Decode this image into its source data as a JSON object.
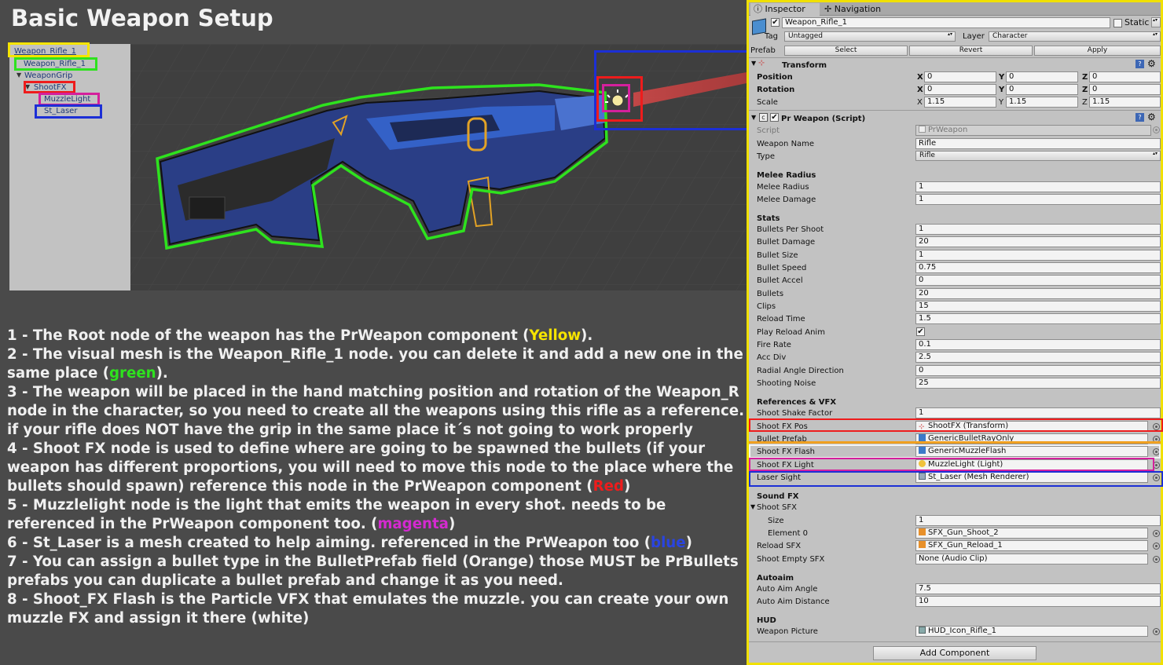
{
  "page_title": "Basic Weapon Setup",
  "hierarchy": {
    "nodes": [
      "Weapon_Rifle_1",
      "Weapon_Rifle_1",
      "WeaponGrip",
      "ShootFX",
      "MuzzleLight",
      "St_Laser"
    ]
  },
  "instructions": {
    "l1_a": "1 - The Root node of the weapon has the PrWeapon component (",
    "l1_hl": "Yellow",
    "l1_b": ").",
    "l2_a": "2 - The visual mesh is the Weapon_Rifle_1 node. you can delete it and add a new one in the same place (",
    "l2_hl": "green",
    "l2_b": ").",
    "l3": "3 - The weapon will be placed in the hand matching position and rotation of the Weapon_R node in the character, so you need to create all the weapons using this rifle as a reference. if your rifle does NOT have the grip in the same place it´s not going to work properly",
    "l4_a": "4 - Shoot FX node is used to define where are going to be spawned the bullets (if your weapon has different proportions, you will need to move this node to the place where the bullets should spawn) reference this node in the PrWeapon component (",
    "l4_hl": "Red",
    "l4_b": ")",
    "l5_a": "5 - Muzzlelight node is the light that emits the weapon in every shot. needs to be referenced in the PrWeapon component too. (",
    "l5_hl": "magenta",
    "l5_b": ")",
    "l6_a": "6 - St_Laser is a mesh created to help aiming. referenced in the PrWeapon too (",
    "l6_hl": "blue",
    "l6_b": ")",
    "l7": "7 - You can assign a bullet type in the BulletPrefab field (Orange) those MUST be PrBullets prefabs you can duplicate a bullet prefab and change it as you need.",
    "l8": "8 - Shoot_FX Flash is the Particle VFX that emulates the muzzle. you can create your own muzzle FX and assign it there (white)"
  },
  "inspector": {
    "tab_inspector": "Inspector",
    "tab_navigation": "Navigation",
    "object_name": "Weapon_Rifle_1",
    "static_label": "Static",
    "tag_label": "Tag",
    "tag_value": "Untagged",
    "layer_label": "Layer",
    "layer_value": "Character",
    "prefab_label": "Prefab",
    "prefab_select": "Select",
    "prefab_revert": "Revert",
    "prefab_apply": "Apply",
    "transform": {
      "title": "Transform",
      "position_label": "Position",
      "rotation_label": "Rotation",
      "scale_label": "Scale",
      "x": "X",
      "y": "Y",
      "z": "Z",
      "pos": [
        "0",
        "0",
        "0"
      ],
      "rot": [
        "0",
        "0",
        "0"
      ],
      "scale": [
        "1.15",
        "1.15",
        "1.15"
      ]
    },
    "script_title": "Pr Weapon (Script)",
    "fields": {
      "script": {
        "label": "Script",
        "value": "PrWeapon"
      },
      "weapon_name": {
        "label": "Weapon Name",
        "value": "Rifle"
      },
      "type": {
        "label": "Type",
        "value": "Rifle"
      },
      "melee_header": "Melee Radius",
      "melee_radius": {
        "label": "Melee Radius",
        "value": "1"
      },
      "melee_damage": {
        "label": "Melee Damage",
        "value": "1"
      },
      "stats_header": "Stats",
      "bullets_per_shoot": {
        "label": "Bullets Per Shoot",
        "value": "1"
      },
      "bullet_damage": {
        "label": "Bullet Damage",
        "value": "20"
      },
      "bullet_size": {
        "label": "Bullet Size",
        "value": "1"
      },
      "bullet_speed": {
        "label": "Bullet Speed",
        "value": "0.75"
      },
      "bullet_accel": {
        "label": "Bullet Accel",
        "value": "0"
      },
      "bullets": {
        "label": "Bullets",
        "value": "20"
      },
      "clips": {
        "label": "Clips",
        "value": "15"
      },
      "reload_time": {
        "label": "Reload Time",
        "value": "1.5"
      },
      "play_reload_anim": {
        "label": "Play Reload Anim",
        "value": "✔"
      },
      "fire_rate": {
        "label": "Fire Rate",
        "value": "0.1"
      },
      "acc_div": {
        "label": "Acc Div",
        "value": "2.5"
      },
      "radial_angle": {
        "label": "Radial Angle Direction",
        "value": "0"
      },
      "shooting_noise": {
        "label": "Shooting Noise",
        "value": "25"
      },
      "refs_header": "References & VFX",
      "shoot_shake": {
        "label": "Shoot Shake Factor",
        "value": "1"
      },
      "shoot_fx_pos": {
        "label": "Shoot FX Pos",
        "value": "ShootFX (Transform)"
      },
      "bullet_prefab": {
        "label": "Bullet Prefab",
        "value": "GenericBulletRayOnly"
      },
      "shoot_fx_flash": {
        "label": "Shoot FX Flash",
        "value": "GenericMuzzleFlash"
      },
      "shoot_fx_light": {
        "label": "Shoot FX Light",
        "value": "MuzzleLight (Light)"
      },
      "laser_sight": {
        "label": "Laser Sight",
        "value": "St_Laser (Mesh Renderer)"
      },
      "sound_header": "Sound FX",
      "shoot_sfx": {
        "label": "Shoot SFX"
      },
      "size": {
        "label": "Size",
        "value": "1"
      },
      "element0": {
        "label": "Element 0",
        "value": "SFX_Gun_Shoot_2"
      },
      "reload_sfx": {
        "label": "Reload SFX",
        "value": "SFX_Gun_Reload_1"
      },
      "shoot_empty_sfx": {
        "label": "Shoot Empty SFX",
        "value": "None (Audio Clip)"
      },
      "autoaim_header": "Autoaim",
      "auto_aim_angle": {
        "label": "Auto Aim Angle",
        "value": "7.5"
      },
      "auto_aim_distance": {
        "label": "Auto Aim Distance",
        "value": "10"
      },
      "hud_header": "HUD",
      "weapon_picture": {
        "label": "Weapon Picture",
        "value": "HUD_Icon_Rifle_1"
      }
    },
    "add_component": "Add Component"
  },
  "colors": {
    "yellow": "#f5e400",
    "green": "#2ee21e",
    "red": "#ee1c1c",
    "magenta": "#d4209c",
    "blue": "#1c2fd6",
    "orange": "#f0a020"
  }
}
